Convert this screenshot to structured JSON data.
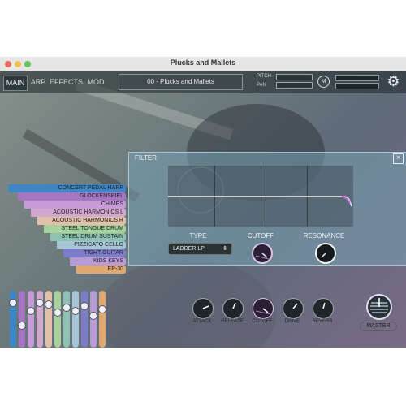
{
  "window": {
    "title": "Plucks and Mallets"
  },
  "tabs": [
    {
      "label": "MAIN"
    },
    {
      "label": "ARP"
    },
    {
      "label": "EFFECTS"
    },
    {
      "label": "MOD"
    }
  ],
  "preset": {
    "name": "00 - Plucks and Mallets"
  },
  "header": {
    "pitch_label": "PITCH",
    "pan_label": "PAN",
    "m_label": "M"
  },
  "filter": {
    "title": "FILTER",
    "type_label": "TYPE",
    "type_value": "LADDER LP",
    "cutoff_label": "CUTOFF",
    "resonance_label": "RESONANCE"
  },
  "layers": [
    {
      "name": "CONCERT PEDAL HARP",
      "color": "#3d87c6"
    },
    {
      "name": "GLOCKENSPIEL",
      "color": "#a676c4"
    },
    {
      "name": "CHIMES",
      "color": "#c79ad8"
    },
    {
      "name": "ACOUSTIC HARMONICS L",
      "color": "#d3a8cf"
    },
    {
      "name": "ACOUSTIC HARMONICS R",
      "color": "#e2c0a9"
    },
    {
      "name": "STEEL TONGUE DRUM",
      "color": "#a8d29c"
    },
    {
      "name": "STEEL DRUM SUSTAIN",
      "color": "#8ec2b0"
    },
    {
      "name": "PIZZICATO CELLO",
      "color": "#a6c5d6"
    },
    {
      "name": "TIGHT GUITAR",
      "color": "#7d7cc9"
    },
    {
      "name": "KIDS KEYS",
      "color": "#b89ad5"
    },
    {
      "name": "EP-30",
      "color": "#e3a870"
    }
  ],
  "knobs": [
    {
      "label": "ATTACK"
    },
    {
      "label": "RELEASE"
    },
    {
      "label": "CUTOFF"
    },
    {
      "label": "DRIVE"
    },
    {
      "label": "REVERB"
    }
  ],
  "master": {
    "label": "MASTER"
  }
}
